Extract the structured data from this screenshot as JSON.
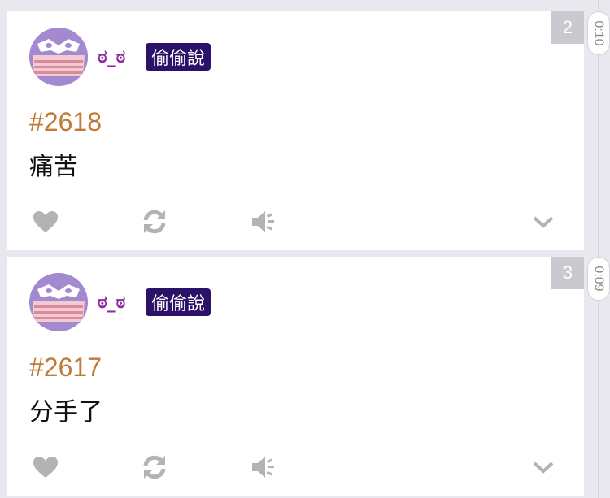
{
  "posts": [
    {
      "index": "2",
      "time": "0:10",
      "username": "ಠ_ಠ",
      "tag": "偷偷說",
      "number": "#2618",
      "text": "痛苦"
    },
    {
      "index": "3",
      "time": "0:09",
      "username": "ಠ_ಠ",
      "tag": "偷偷說",
      "number": "#2617",
      "text": "分手了"
    }
  ],
  "icons": {
    "like": "heart-icon",
    "repost": "refresh-icon",
    "speak": "speaker-icon",
    "more": "chevron-down-icon"
  },
  "colors": {
    "username": "#8e2fa0",
    "tag_bg": "#2c1168",
    "post_number": "#c07a35",
    "icon": "#b3b3b3",
    "avatar_bg": "#a38ad0"
  }
}
